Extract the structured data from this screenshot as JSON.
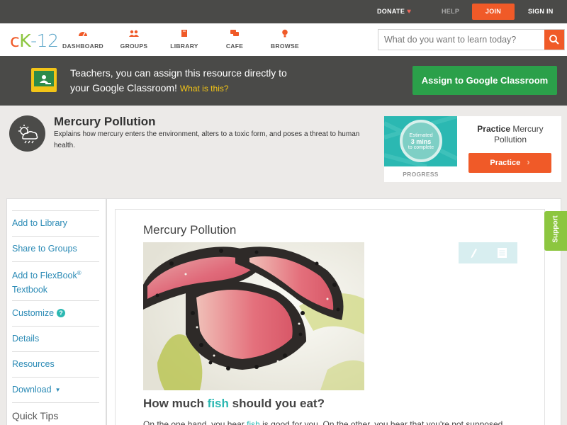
{
  "topbar": {
    "donate": "DONATE",
    "help": "HELP",
    "join": "JOIN",
    "sign_in": "SIGN IN"
  },
  "nav": {
    "logo_c": "c",
    "logo_k": "K",
    "logo_num": "-12",
    "items": [
      {
        "label": "DASHBOARD",
        "icon": "dashboard-icon"
      },
      {
        "label": "GROUPS",
        "icon": "groups-icon"
      },
      {
        "label": "LIBRARY",
        "icon": "library-icon"
      },
      {
        "label": "CAFE",
        "icon": "cafe-icon"
      },
      {
        "label": "BROWSE",
        "icon": "browse-icon"
      }
    ],
    "search_placeholder": "What do you want to learn today?"
  },
  "banner": {
    "line1": "Teachers, you can assign this resource directly to",
    "line2": "your Google Classroom!",
    "link": "What is this?",
    "assign_button": "Assign to Google Classroom"
  },
  "topic": {
    "title": "Mercury Pollution",
    "description": "Explains how mercury enters the environment, alters to a toxic form, and poses a threat to human health."
  },
  "practice": {
    "estimated": "Estimated",
    "mins": "3 mins",
    "to_complete": "to complete",
    "progress_label": "PROGRESS",
    "title_bold": "Practice",
    "title_rest": "Mercury Pollution",
    "button": "Practice"
  },
  "sidebar": {
    "add_to_library": "Add to Library",
    "share_to_groups": "Share to Groups",
    "add_to_flexbook_1": "Add to FlexBook",
    "add_to_flexbook_reg": "®",
    "add_to_flexbook_2": "Textbook",
    "customize": "Customize",
    "customize_help": "?",
    "details": "Details",
    "resources": "Resources",
    "download": "Download",
    "quick_tips": "Quick Tips"
  },
  "content": {
    "lesson_title": "Mercury Pollution",
    "heading_pre": "How much ",
    "heading_hl": "fish",
    "heading_post": " should you eat?",
    "para_pre": "On the one hand, you hear ",
    "para_hl": "fish",
    "para_post": " is good for you. On the other, you hear that you're not supposed"
  },
  "support": "Support",
  "colors": {
    "brand_orange": "#f05a28",
    "brand_green": "#8cc63f",
    "teal": "#2bb8b2",
    "link_blue": "#2a8ab5",
    "classroom_green": "#2ba04a"
  }
}
